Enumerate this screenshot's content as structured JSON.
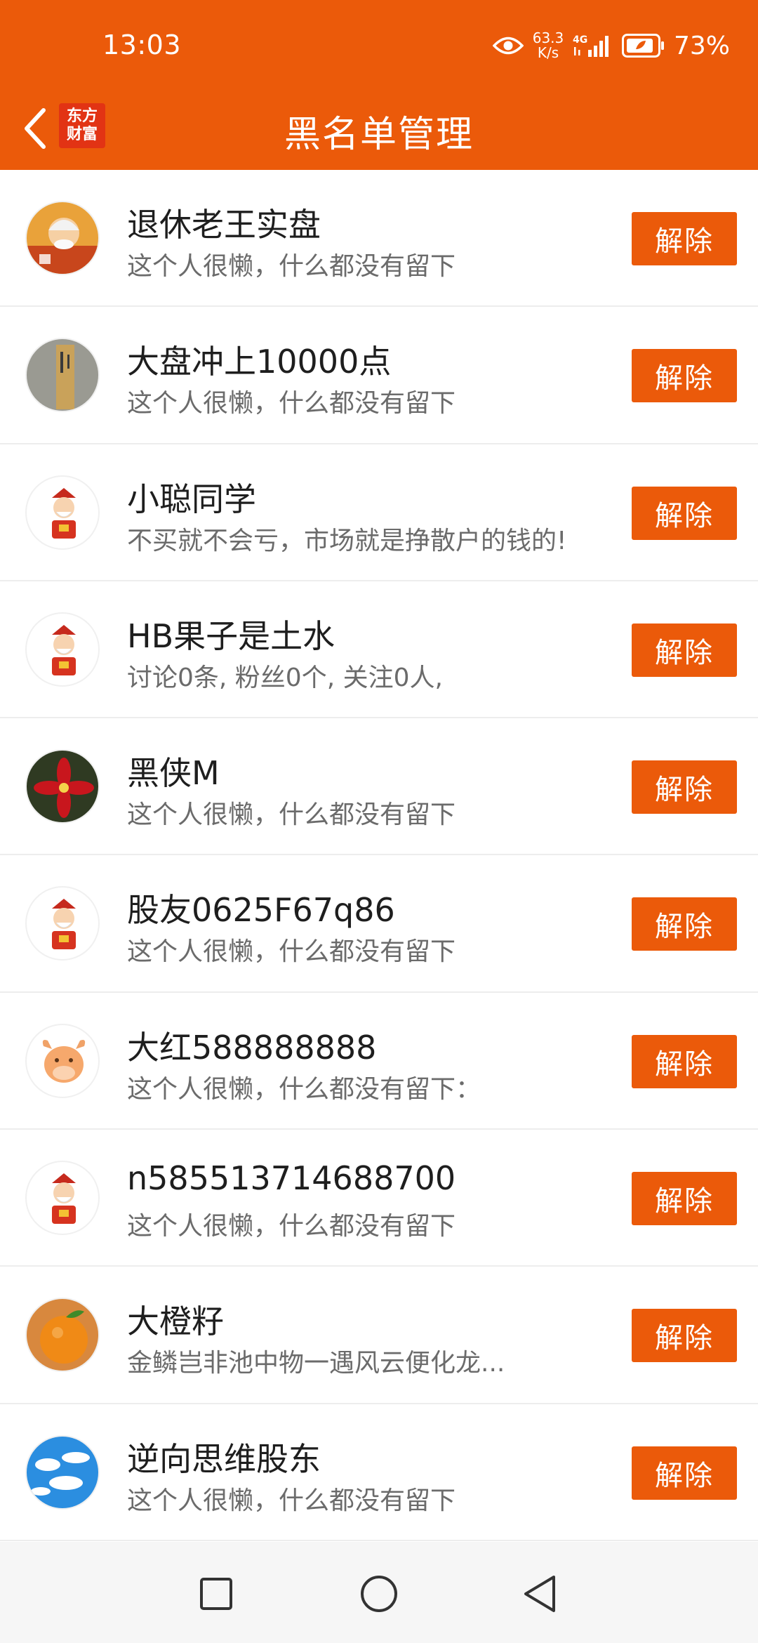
{
  "status_bar": {
    "time": "13:03",
    "net_speed_value": "63.3",
    "net_speed_unit": "K/s",
    "network_type": "4G",
    "battery": "73%"
  },
  "header": {
    "title": "黑名单管理",
    "logo_line1": "东方",
    "logo_line2": "财富",
    "accent_color": "#EB5A0A"
  },
  "blocked_users": [
    {
      "name": "退休老王实盘",
      "bio": "这个人很懒，什么都没有留下",
      "action": "解除",
      "avatar": "old-man-avatar"
    },
    {
      "name": "大盘冲上10000点",
      "bio": "这个人很懒，什么都没有留下",
      "action": "解除",
      "avatar": "calligraphy-avatar"
    },
    {
      "name": "小聪同学",
      "bio": "不买就不会亏，市场就是挣散户的钱的!",
      "action": "解除",
      "avatar": "fortune-god-avatar"
    },
    {
      "name": "HB果子是土水",
      "bio": "讨论0条, 粉丝0个, 关注0人,",
      "action": "解除",
      "avatar": "fortune-god-avatar"
    },
    {
      "name": "黑侠M",
      "bio": "这个人很懒，什么都没有留下",
      "action": "解除",
      "avatar": "red-flower-avatar"
    },
    {
      "name": "股友0625F67q86",
      "bio": "这个人很懒，什么都没有留下",
      "action": "解除",
      "avatar": "fortune-god-avatar"
    },
    {
      "name": "大红588888888",
      "bio": "这个人很懒，什么都没有留下：",
      "action": "解除",
      "avatar": "bull-avatar"
    },
    {
      "name": "n585513714688700",
      "bio": "这个人很懒，什么都没有留下",
      "action": "解除",
      "avatar": "fortune-god-avatar"
    },
    {
      "name": "大橙籽",
      "bio": "金鳞岂非池中物一遇风云便化龙...",
      "action": "解除",
      "avatar": "orange-avatar"
    },
    {
      "name": "逆向思维股东",
      "bio": "这个人很懒，什么都没有留下",
      "action": "解除",
      "avatar": "sky-clouds-avatar"
    }
  ],
  "nav": {
    "recent": "square-icon",
    "home": "circle-icon",
    "back": "triangle-back-icon"
  }
}
